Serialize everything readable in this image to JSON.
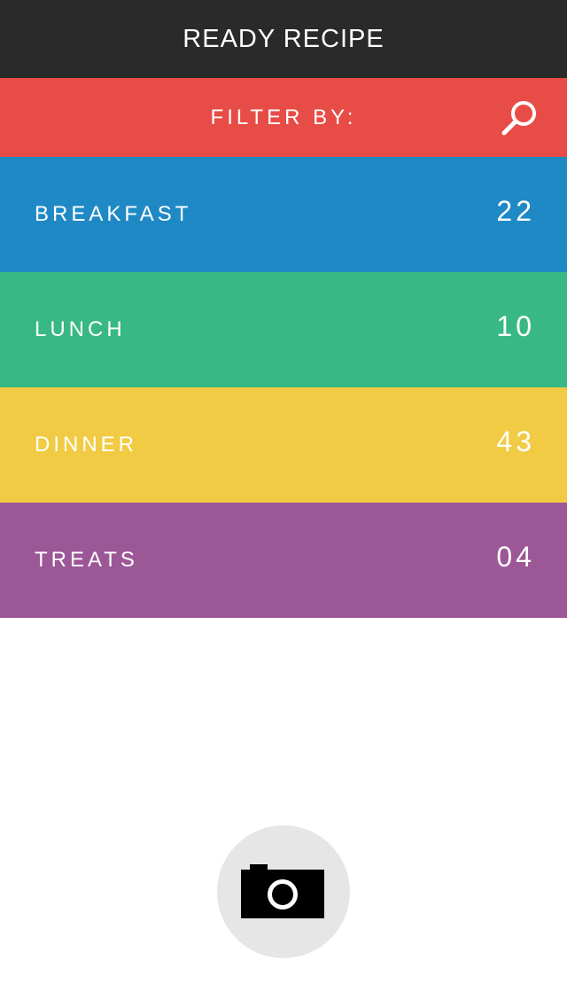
{
  "header": {
    "title": "READY RECIPE"
  },
  "filter": {
    "label": "FILTER BY:",
    "search_icon": "search-icon",
    "color": "#e84c46"
  },
  "categories": [
    {
      "label": "BREAKFAST",
      "count": "22",
      "color": "#1f89c6"
    },
    {
      "label": "LUNCH",
      "count": "10",
      "color": "#38b885"
    },
    {
      "label": "DINNER",
      "count": "43",
      "color": "#f1cb44"
    },
    {
      "label": "TREATS",
      "count": "04",
      "color": "#9c5796"
    }
  ],
  "camera": {
    "icon": "camera-icon"
  }
}
